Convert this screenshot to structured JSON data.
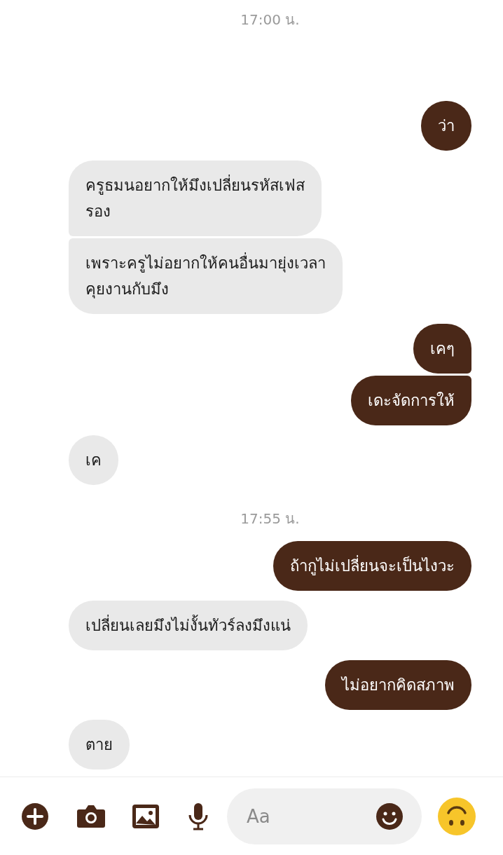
{
  "messages": [
    {
      "kind": "time",
      "text": "17:00 น."
    },
    {
      "kind": "sent",
      "text": "ว่า"
    },
    {
      "kind": "received",
      "text": "ครูธมนอยากให้มึงเปลี่ยนรหัสเฟส\nรอง"
    },
    {
      "kind": "received",
      "text": "เพราะครูไม่อยากให้คนอื่นมายุ่งเวลา\nคุยงานกับมึง"
    },
    {
      "kind": "sent",
      "text": "เคๆ"
    },
    {
      "kind": "sent",
      "text": "เดะจัดการให้"
    },
    {
      "kind": "received",
      "text": "เค"
    },
    {
      "kind": "time",
      "text": "17:55 น."
    },
    {
      "kind": "sent",
      "text": "ถ้ากูไม่เปลี่ยนจะเป็นไงวะ"
    },
    {
      "kind": "received",
      "text": "เปลี่ยนเลยมึงไม่งั้นทัวร์ลงมึงแน่"
    },
    {
      "kind": "sent",
      "text": "ไม่อยากคิดสภาพ"
    },
    {
      "kind": "received",
      "text": "ตาย"
    }
  ],
  "composer": {
    "placeholder": "Aa"
  }
}
